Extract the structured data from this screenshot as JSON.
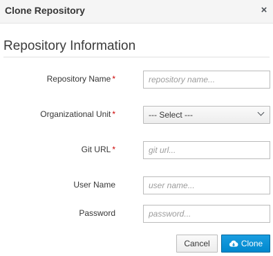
{
  "dialog": {
    "title": "Clone Repository",
    "close_glyph": "×"
  },
  "section": {
    "title": "Repository Information"
  },
  "form": {
    "repository_name": {
      "label": "Repository Name",
      "required_mark": "*",
      "placeholder": "repository name...",
      "value": ""
    },
    "organizational_unit": {
      "label": "Organizational Unit",
      "required_mark": "*",
      "selected": "--- Select ---"
    },
    "git_url": {
      "label": "Git URL",
      "required_mark": "*",
      "placeholder": "git url...",
      "value": ""
    },
    "user_name": {
      "label": "User Name",
      "placeholder": "user name...",
      "value": ""
    },
    "password": {
      "label": "Password",
      "placeholder": "password...",
      "value": ""
    }
  },
  "footer": {
    "cancel_label": "Cancel",
    "clone_label": "Clone",
    "clone_icon": "cloud-download-icon"
  },
  "colors": {
    "primary": "#0088ce",
    "required": "#cc0000",
    "header_bg": "#f5f5f5"
  }
}
